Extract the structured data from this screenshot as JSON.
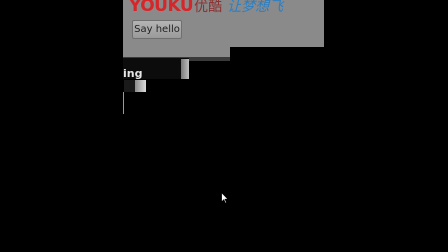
{
  "header": {
    "logo_brand": "YOUKU",
    "logo_cn_name": "优酷",
    "logo_slogan": "让梦想飞"
  },
  "toolbar": {
    "say_hello_label": "Say hello"
  },
  "status": {
    "text": "ing"
  },
  "colors": {
    "background": "#000000",
    "panel": "#8a8a8a",
    "brand_red": "#d7262a",
    "slogan_blue": "#2b7fc4"
  },
  "icons": {
    "cursor": "mouse-pointer-icon"
  }
}
